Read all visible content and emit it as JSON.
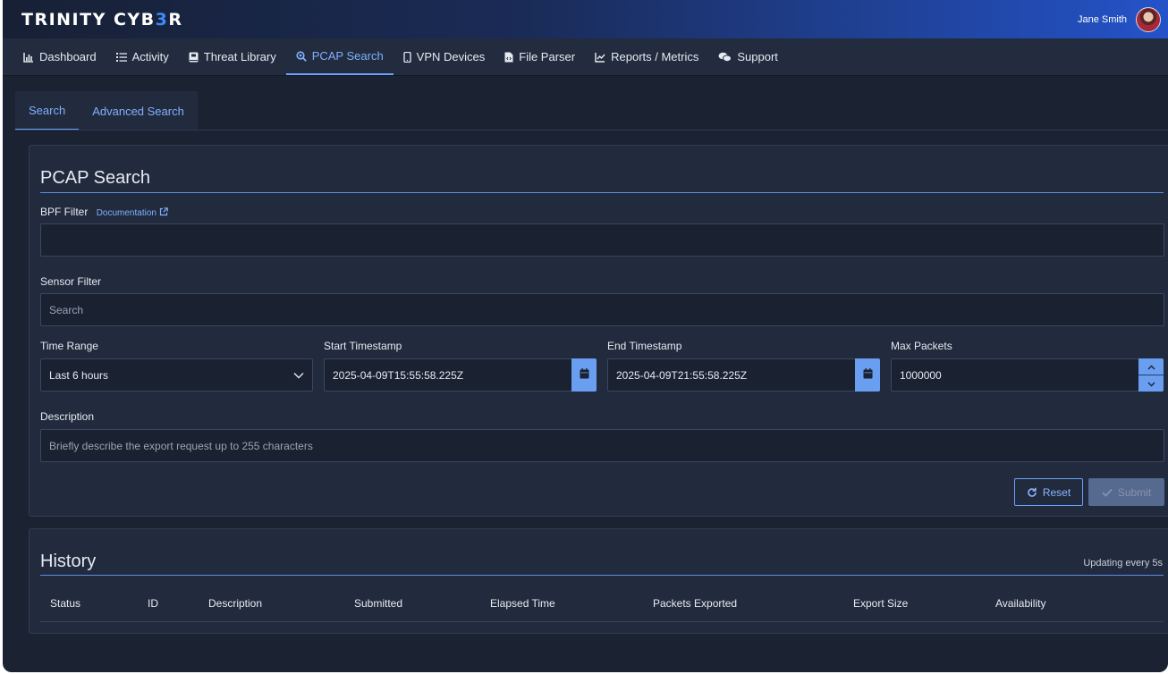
{
  "brand": {
    "logo_main": "TRINITY CYB",
    "logo_accent": "3",
    "logo_end": "R"
  },
  "user": {
    "name": "Jane Smith"
  },
  "nav": {
    "items": [
      {
        "label": "Dashboard",
        "icon": "bar-chart-icon"
      },
      {
        "label": "Activity",
        "icon": "list-icon"
      },
      {
        "label": "Threat Library",
        "icon": "book-icon"
      },
      {
        "label": "PCAP Search",
        "icon": "magnifier-icon"
      },
      {
        "label": "VPN Devices",
        "icon": "mobile-icon"
      },
      {
        "label": "File Parser",
        "icon": "file-code-icon"
      },
      {
        "label": "Reports / Metrics",
        "icon": "line-chart-icon"
      },
      {
        "label": "Support",
        "icon": "chat-bubbles-icon"
      }
    ],
    "active": "PCAP Search"
  },
  "tabs": [
    {
      "label": "Search"
    },
    {
      "label": "Advanced Search"
    }
  ],
  "search_form": {
    "title": "PCAP Search",
    "bpf_label": "BPF Filter",
    "doc_link": "Documentation",
    "bpf_value": "",
    "sensor_label": "Sensor Filter",
    "sensor_placeholder": "Search",
    "time_range_label": "Time Range",
    "time_range_value": "Last 6 hours",
    "start_label": "Start Timestamp",
    "start_value": "2025-04-09T15:55:58.225Z",
    "end_label": "End Timestamp",
    "end_value": "2025-04-09T21:55:58.225Z",
    "max_packets_label": "Max Packets",
    "max_packets_value": "1000000",
    "description_label": "Description",
    "description_placeholder": "Briefly describe the export request up to 255 characters",
    "reset_label": "Reset",
    "submit_label": "Submit"
  },
  "history": {
    "title": "History",
    "updating": "Updating every 5s",
    "columns": [
      "Status",
      "ID",
      "Description",
      "Submitted",
      "Elapsed Time",
      "Packets Exported",
      "Export Size",
      "Availability"
    ]
  },
  "colors": {
    "accent": "#6a9ef0",
    "link": "#7fb0ff",
    "background": "#1b2232",
    "panel": "#222b3d"
  }
}
